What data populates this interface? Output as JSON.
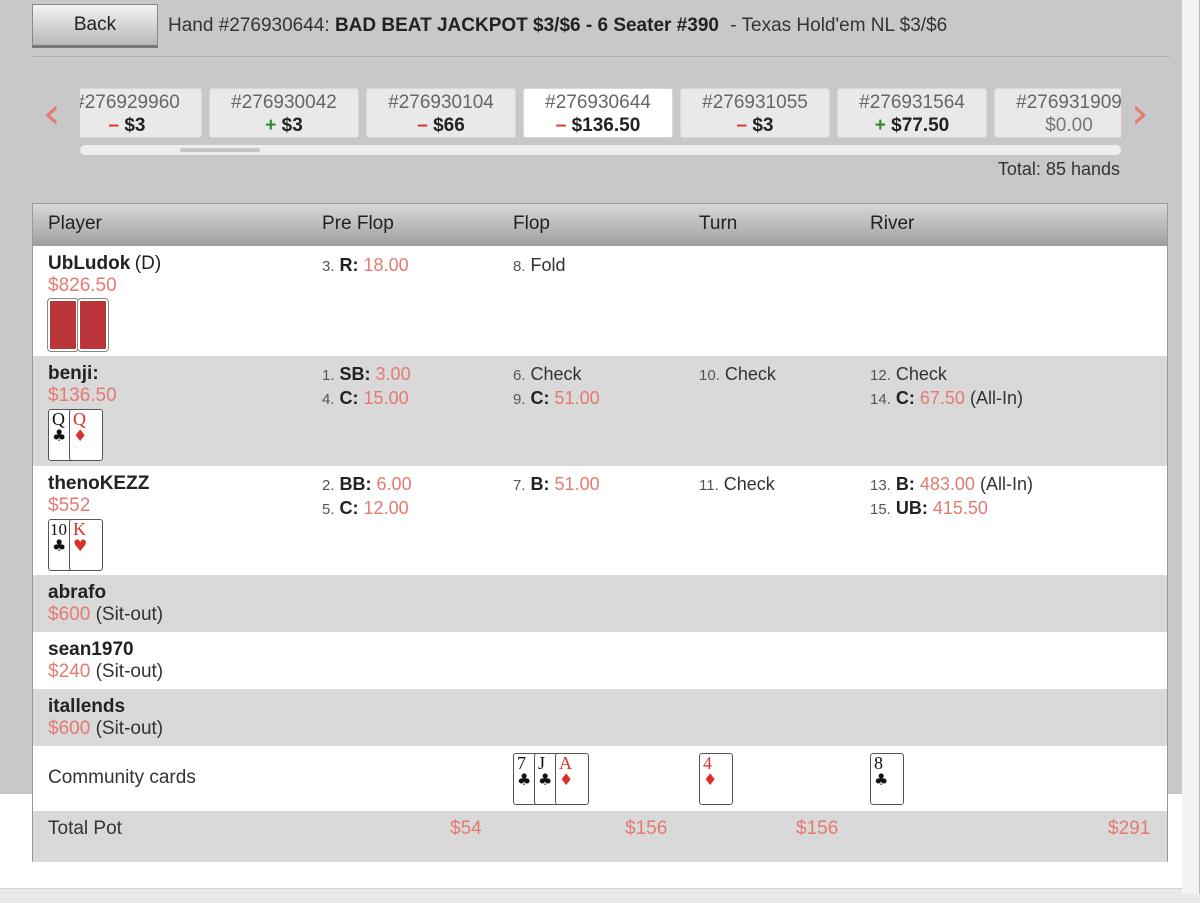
{
  "header": {
    "back_label": "Back",
    "hand_prefix": "Hand #276930644:",
    "hand_title": "BAD BEAT JACKPOT $3/$6 - 6 Seater #390",
    "game": "- Texas Hold'em NL  $3/$6"
  },
  "carousel": {
    "hands": [
      {
        "num": "#276929960",
        "sign": "–",
        "amount": "$3"
      },
      {
        "num": "#276930042",
        "sign": "+",
        "amount": "$3"
      },
      {
        "num": "#276930104",
        "sign": "–",
        "amount": "$66"
      },
      {
        "num": "#276930644",
        "sign": "–",
        "amount": "$136.50"
      },
      {
        "num": "#276931055",
        "sign": "–",
        "amount": "$3"
      },
      {
        "num": "#276931564",
        "sign": "+",
        "amount": "$77.50"
      },
      {
        "num": "#276931909",
        "sign": "",
        "amount": "$0.00"
      }
    ],
    "total": "Total: 85 hands"
  },
  "table": {
    "columns": [
      "Player",
      "Pre Flop",
      "Flop",
      "Turn",
      "River"
    ],
    "players": [
      {
        "name": "UbLudok",
        "pos": "(D)",
        "stack": "$826.50"
      },
      {
        "name": "benji:",
        "stack": "$136.50"
      },
      {
        "name": "thenoKEZZ",
        "stack": "$552"
      },
      {
        "name": "abrafo",
        "stack": "$600",
        "status": "(Sit-out)"
      },
      {
        "name": "sean1970",
        "stack": "$240",
        "status": "(Sit-out)"
      },
      {
        "name": "itallends",
        "stack": "$600",
        "status": "(Sit-out)"
      }
    ],
    "actions": {
      "a1": {
        "n": "1.",
        "t": "SB:",
        "v": "3.00"
      },
      "a2": {
        "n": "2.",
        "t": "BB:",
        "v": "6.00"
      },
      "a3": {
        "n": "3.",
        "t": "R:",
        "v": "18.00"
      },
      "a4": {
        "n": "4.",
        "t": "C:",
        "v": "15.00"
      },
      "a5": {
        "n": "5.",
        "t": "C:",
        "v": "12.00"
      },
      "a6": {
        "n": "6.",
        "t": "Check"
      },
      "a7": {
        "n": "7.",
        "t": "B:",
        "v": "51.00"
      },
      "a8": {
        "n": "8.",
        "t": "Fold"
      },
      "a9": {
        "n": "9.",
        "t": "C:",
        "v": "51.00"
      },
      "a10": {
        "n": "10.",
        "t": "Check"
      },
      "a11": {
        "n": "11.",
        "t": "Check"
      },
      "a12": {
        "n": "12.",
        "t": "Check"
      },
      "a13": {
        "n": "13.",
        "t": "B:",
        "v": "483.00",
        "x": "(All-In)"
      },
      "a14": {
        "n": "14.",
        "t": "C:",
        "v": "67.50",
        "x": "(All-In)"
      },
      "a15": {
        "n": "15.",
        "t": "UB:",
        "v": "415.50"
      }
    },
    "hole_cards": {
      "benji": [
        {
          "rank": "Q",
          "suit": "♣",
          "color": "black"
        },
        {
          "rank": "Q",
          "suit": "♦",
          "color": "red"
        }
      ],
      "theno": [
        {
          "rank": "10",
          "suit": "♣",
          "color": "black"
        },
        {
          "rank": "K",
          "suit": "♥",
          "color": "red"
        }
      ]
    },
    "community_label": "Community cards",
    "flop": [
      {
        "rank": "7",
        "suit": "♣"
      },
      {
        "rank": "J",
        "suit": "♣"
      },
      {
        "rank": "A",
        "suit": "♦"
      }
    ],
    "turn": [
      {
        "rank": "4",
        "suit": "♦"
      }
    ],
    "river": [
      {
        "rank": "8",
        "suit": "♣"
      }
    ],
    "pot_label": "Total Pot",
    "pots": [
      "$54",
      "$156",
      "$156",
      "$291"
    ]
  },
  "colors": {
    "accent": "#e57a72",
    "minus": "#d9322b",
    "plus": "#2e8b2e"
  }
}
